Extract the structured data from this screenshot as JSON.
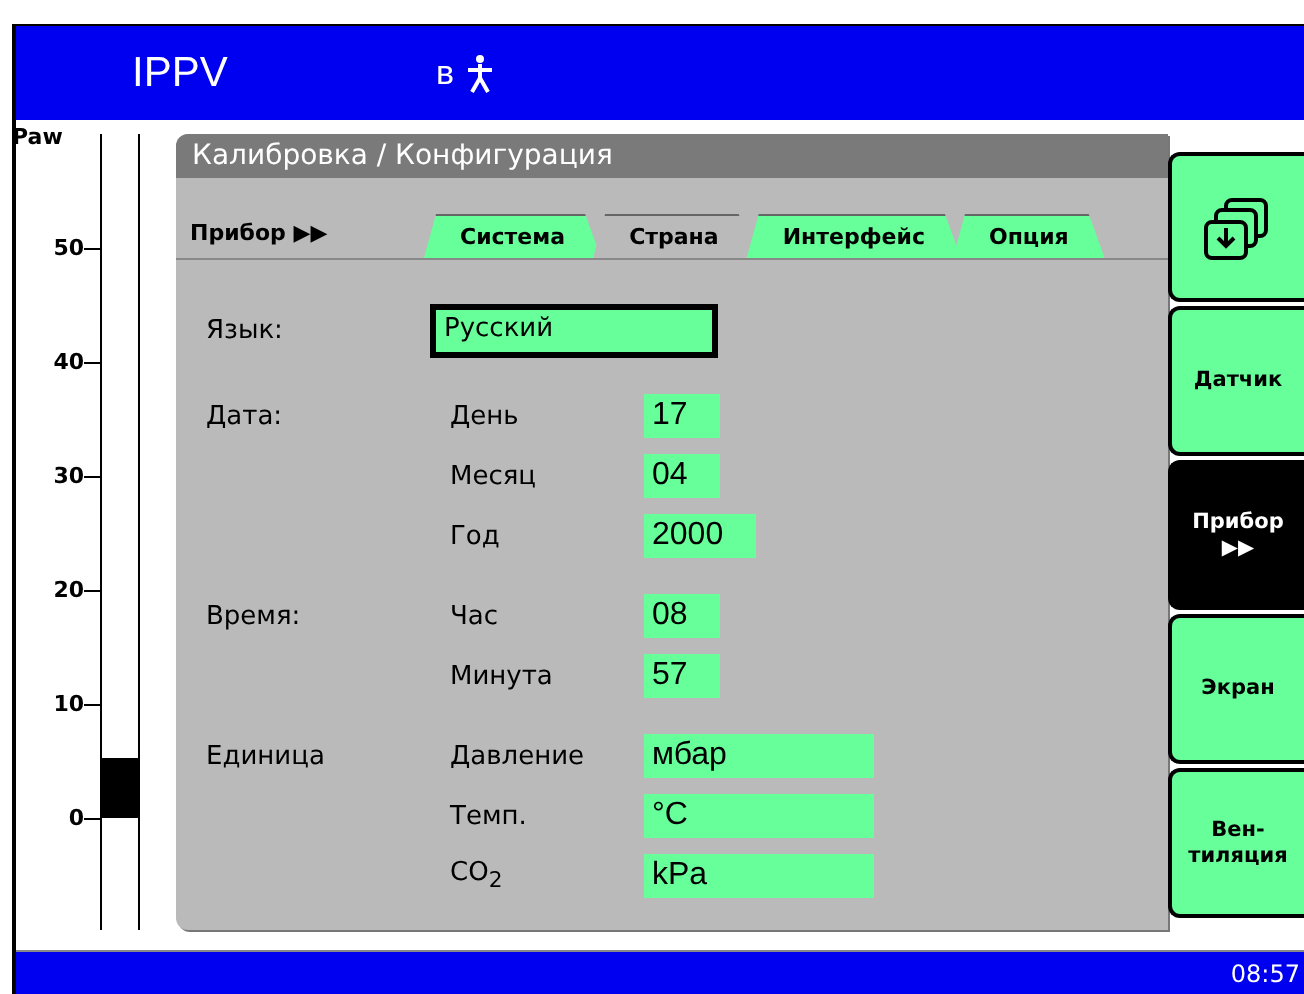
{
  "header": {
    "mode": "IPPV",
    "patient": "в"
  },
  "gauge": {
    "label": "Paw",
    "ticks": [
      "50",
      "40",
      "30",
      "20",
      "10",
      "0"
    ],
    "level": 0.105
  },
  "panel": {
    "title": "Калибровка / Конфигурация",
    "section": "Прибор ▶▶",
    "tabs": [
      {
        "label": "Система",
        "selected": false
      },
      {
        "label": "Страна",
        "selected": true
      },
      {
        "label": "Интерфейс",
        "selected": false
      },
      {
        "label": "Опция",
        "selected": false
      }
    ]
  },
  "language": {
    "label": "Язык:",
    "value": "Русский"
  },
  "groups": [
    {
      "label": "Дата:",
      "fields": [
        {
          "label": "День",
          "value": "17",
          "kind": "short"
        },
        {
          "label": "Месяц",
          "value": "04",
          "kind": "short"
        },
        {
          "label": "Год",
          "value": "2000",
          "kind": "medium"
        }
      ]
    },
    {
      "label": "Время:",
      "fields": [
        {
          "label": "Час",
          "value": "08",
          "kind": "short"
        },
        {
          "label": "Минута",
          "value": "57",
          "kind": "short"
        }
      ]
    },
    {
      "label": "Единица",
      "fields": [
        {
          "label": "Давление",
          "value": "мбар",
          "kind": "wide"
        },
        {
          "label": "Темп.",
          "value": "°C",
          "kind": "wide"
        },
        {
          "label": "CO$_{2}$",
          "value": "kPa",
          "kind": "wide"
        }
      ]
    }
  ],
  "side_buttons": [
    {
      "kind": "icon",
      "selected": false
    },
    {
      "kind": "text",
      "lines": [
        "Датчик"
      ],
      "selected": false
    },
    {
      "kind": "text",
      "lines": [
        "Прибор",
        "▶▶"
      ],
      "selected": true
    },
    {
      "kind": "text",
      "lines": [
        "Экран"
      ],
      "selected": false
    },
    {
      "kind": "text",
      "lines": [
        "Вен-",
        "тиляция"
      ],
      "selected": false
    }
  ],
  "status_bar": {
    "time": "08:57"
  }
}
